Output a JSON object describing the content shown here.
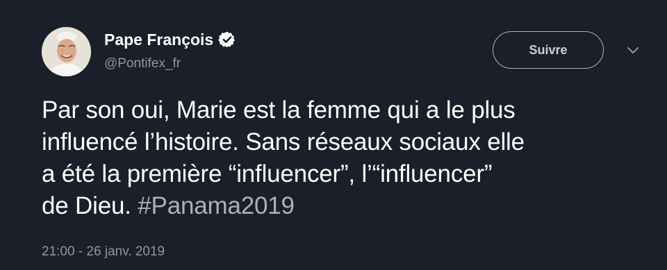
{
  "author": {
    "name": "Pape François",
    "handle": "@Pontifex_fr",
    "verified": true
  },
  "actions": {
    "follow_label": "Suivre",
    "menu_icon": "chevron-down-icon"
  },
  "tweet": {
    "lines": [
      "Par son oui, Marie est la femme qui a le plus",
      "influencé l’histoire. Sans réseaux sociaux elle",
      "a été la première “influencer”, l’“influencer”",
      "de Dieu. "
    ],
    "hashtag": "#Panama2019",
    "timestamp": "21:00 - 26 janv. 2019"
  },
  "colors": {
    "background": "#1b1f29",
    "text": "#ffffff",
    "secondary_text": "#8b98a5",
    "hashtag": "#a7b3bf"
  }
}
